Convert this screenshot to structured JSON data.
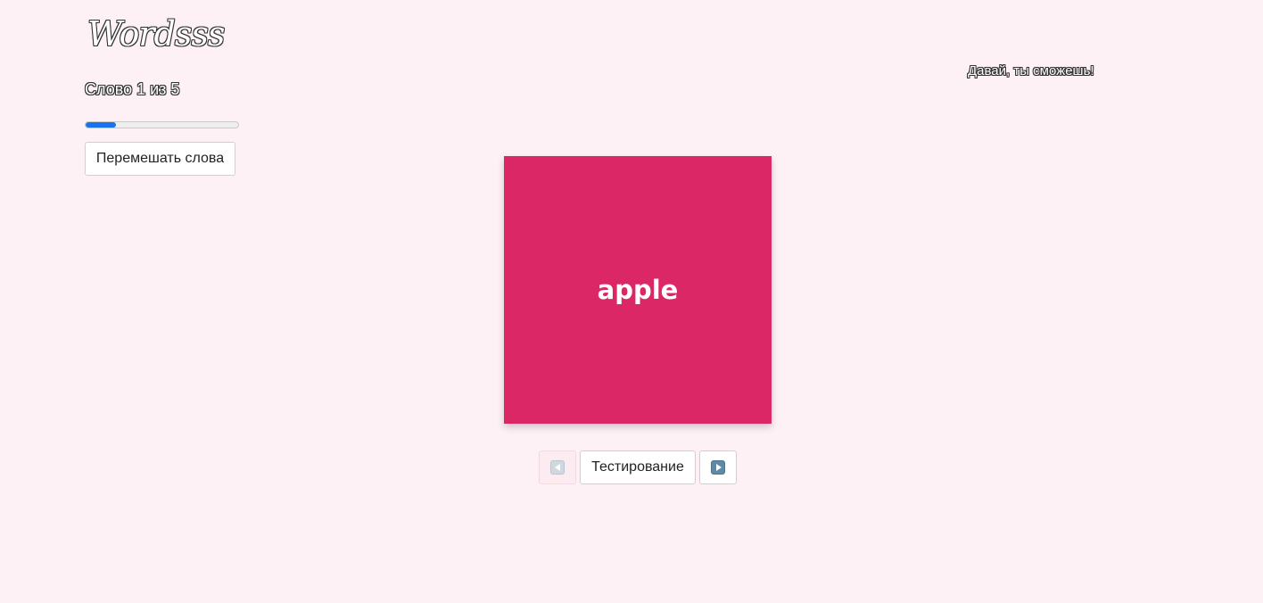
{
  "header": {
    "logo_text": "Wordsss",
    "motivation": "Давай, ты сможешь!"
  },
  "progress": {
    "counter_text": "Слово 1 из 5",
    "current": 1,
    "total": 5,
    "fraction": 0.2,
    "fill_color": "#1a73e8"
  },
  "toolbar": {
    "shuffle_label": "Перемешать слова"
  },
  "card": {
    "word": "apple",
    "color": "#dc2766"
  },
  "navigation": {
    "prev_icon": "arrow-left-icon",
    "test_label": "Тестирование",
    "next_icon": "arrow-right-icon"
  },
  "colors": {
    "background": "#fef1f5"
  }
}
